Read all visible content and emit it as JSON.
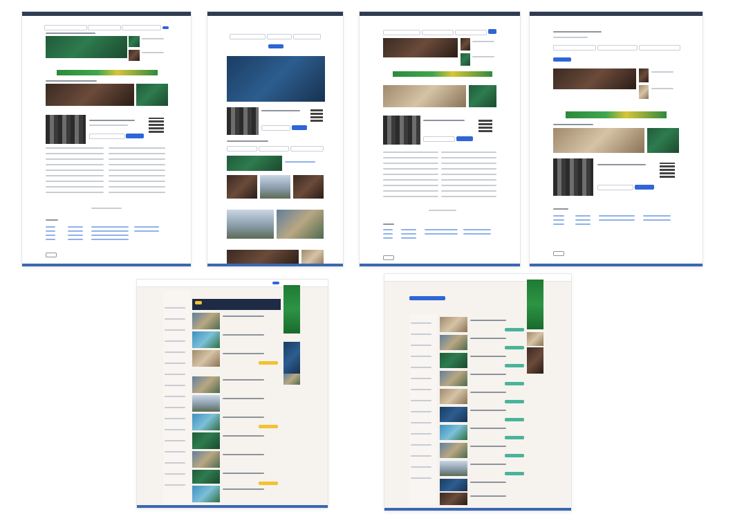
{
  "screenshots": [
    {
      "name": "home-page"
    },
    {
      "name": "article-page"
    },
    {
      "name": "hotel-page"
    },
    {
      "name": "destination-page"
    },
    {
      "name": "search-results-page-1"
    },
    {
      "name": "search-results-page-2"
    }
  ],
  "colors": {
    "header_bar": "#2f3c52",
    "footer_bar": "#3a67b0",
    "accent_blue": "#2e66d6",
    "ad_green": "#2e8b40",
    "price_yellow": "#f1c232",
    "price_teal": "#4ab399"
  }
}
